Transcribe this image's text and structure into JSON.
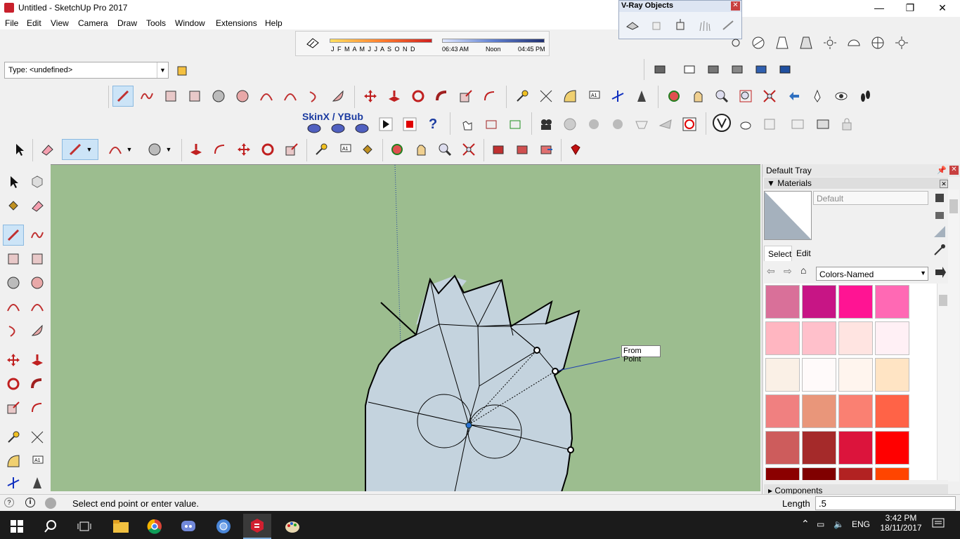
{
  "window": {
    "title": "Untitled - SketchUp Pro 2017",
    "minimize": "—",
    "maximize": "❐",
    "close": "✕"
  },
  "menu": [
    "File",
    "Edit",
    "View",
    "Camera",
    "Draw",
    "Tools",
    "Window",
    "Extensions",
    "Help"
  ],
  "shadow": {
    "months": "J F M A M J J A S O N D",
    "time_start": "06:43 AM",
    "time_mid": "Noon",
    "time_end": "04:45 PM"
  },
  "type_combo": {
    "value": "Type: <undefined>"
  },
  "vray": {
    "title": "V-Ray Objects"
  },
  "skinx": {
    "label": "SkinX / YBub"
  },
  "viewport": {
    "tooltip": "From Point",
    "bg_color": "#9cbd8f",
    "face_color": "#c4d3de"
  },
  "tray": {
    "title": "Default Tray",
    "materials_label": "Materials",
    "material_name": "Default",
    "tab_select": "Select",
    "tab_edit": "Edit",
    "library": "Colors-Named",
    "components_label": "Components",
    "swatches": [
      "#d97099",
      "#c71585",
      "#ff1493",
      "#ff69b4",
      "#ffb6c1",
      "#ffc0cb",
      "#ffe4e1",
      "#fff0f5",
      "#faf0e6",
      "#fffafa",
      "#fff5ee",
      "#ffe4c4",
      "#f08080",
      "#e9967a",
      "#fa8072",
      "#ff6347",
      "#cd5c5c",
      "#a52a2a",
      "#dc143c",
      "#ff0000",
      "#8b0000",
      "#800000",
      "#b22222",
      "#ff4500"
    ]
  },
  "status": {
    "message": "Select end point or enter value.",
    "length_label": "Length",
    "length_value": ".5"
  },
  "taskbar": {
    "lang": "ENG",
    "time": "3:42 PM",
    "date": "18/11/2017"
  }
}
